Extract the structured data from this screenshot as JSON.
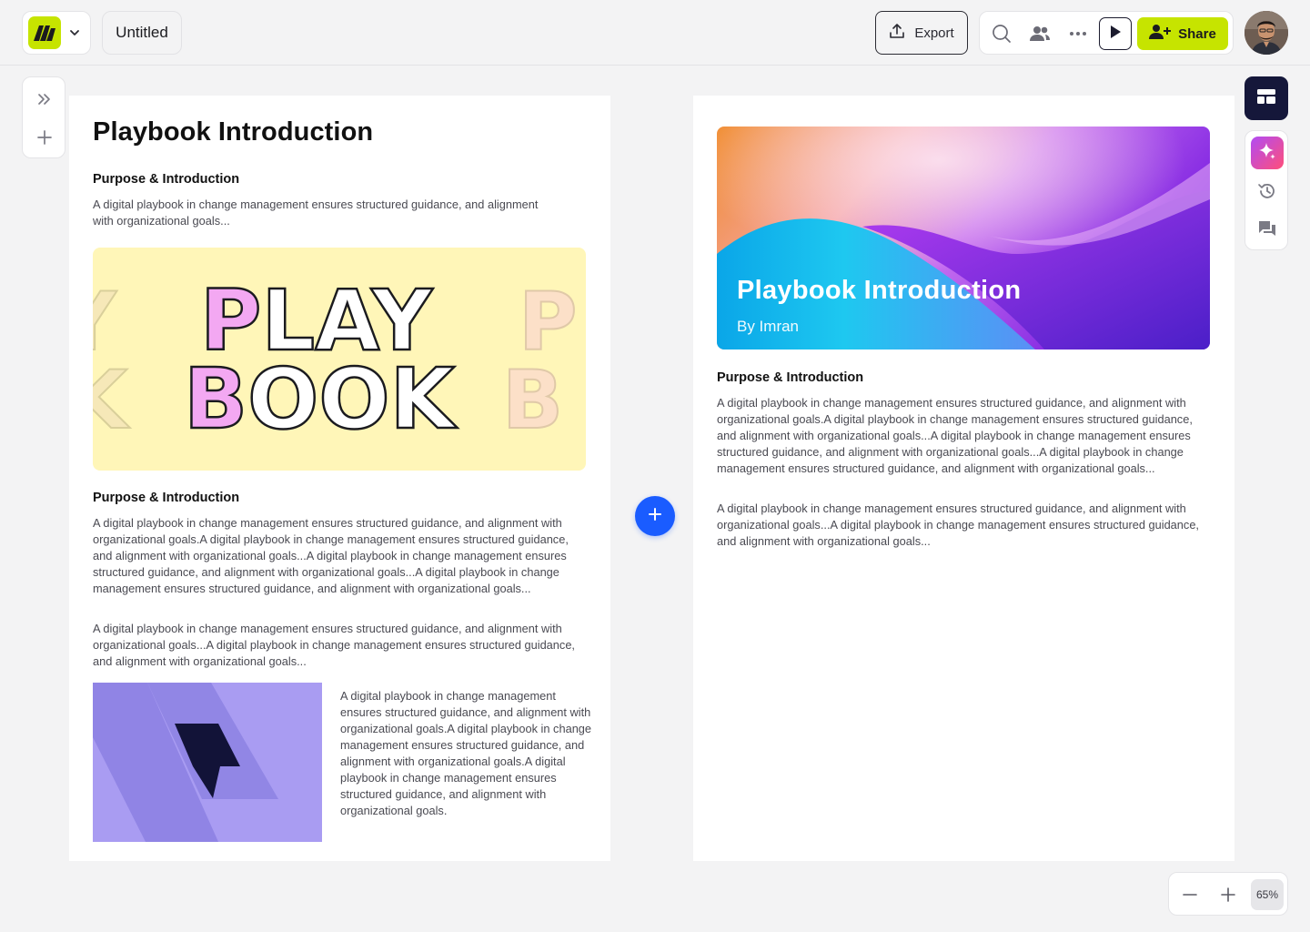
{
  "header": {
    "doc_title": "Untitled",
    "export_label": "Export",
    "share_label": "Share"
  },
  "left_page": {
    "title": "Playbook Introduction",
    "section1_heading": "Purpose & Introduction",
    "section1_text": "A digital playbook in change management ensures structured guidance, and alignment with organizational goals...",
    "section2_heading": "Purpose & Introduction",
    "section2_text": "A digital playbook in change management ensures structured guidance, and alignment with organizational goals.A digital playbook in change management ensures structured guidance, and alignment with organizational goals...A digital playbook in change management ensures structured guidance, and alignment with organizational goals...A digital playbook in change management ensures structured guidance, and alignment with organizational goals...",
    "section3_text": "A digital playbook in change management ensures structured guidance, and alignment with organizational goals...A digital playbook in change management ensures structured guidance, and alignment with organizational goals...",
    "side_text": "A digital playbook in change management ensures structured guidance, and alignment with organizational goals.A digital playbook in change management ensures structured guidance, and alignment with organizational goals.A digital playbook in change management ensures structured guidance, and alignment with organizational goals.",
    "playbook_art": {
      "line1": "PLAY",
      "line2": "BOOK",
      "ghost_left_1": "Y",
      "ghost_left_2": "K",
      "ghost_right_1": "P",
      "ghost_right_2": "B"
    }
  },
  "right_page": {
    "hero_title": "Playbook Introduction",
    "hero_subtitle": "By Imran",
    "section_heading": "Purpose & Introduction",
    "text1": "A digital playbook in change management ensures structured guidance, and alignment with organizational goals.A digital playbook in change management ensures structured guidance, and alignment with organizational goals...A digital playbook in change management ensures structured guidance, and alignment with organizational goals...A digital playbook in change management ensures structured guidance, and alignment with organizational goals...",
    "text2": "A digital playbook in change management ensures structured guidance, and alignment with organizational goals...A digital playbook in change management ensures structured guidance, and alignment with organizational goals..."
  },
  "zoom": {
    "value": "65%"
  },
  "icons": {
    "logo": "logo-icon",
    "chevron": "chevron-down-icon",
    "export": "upload-icon",
    "search": "search-icon",
    "collaborators": "users-icon",
    "more": "more-horizontal-icon",
    "play": "play-icon",
    "share": "user-plus-icon",
    "expand": "double-chevron-right-icon",
    "add": "plus-icon",
    "layout": "layout-icon",
    "ai": "sparkle-icon",
    "history": "history-icon",
    "comments": "comments-icon",
    "zoom_out": "minus-icon",
    "zoom_in": "plus-icon"
  },
  "colors": {
    "accent": "#c6e400",
    "primary_blue": "#1a5cff",
    "dark": "#15173a"
  }
}
